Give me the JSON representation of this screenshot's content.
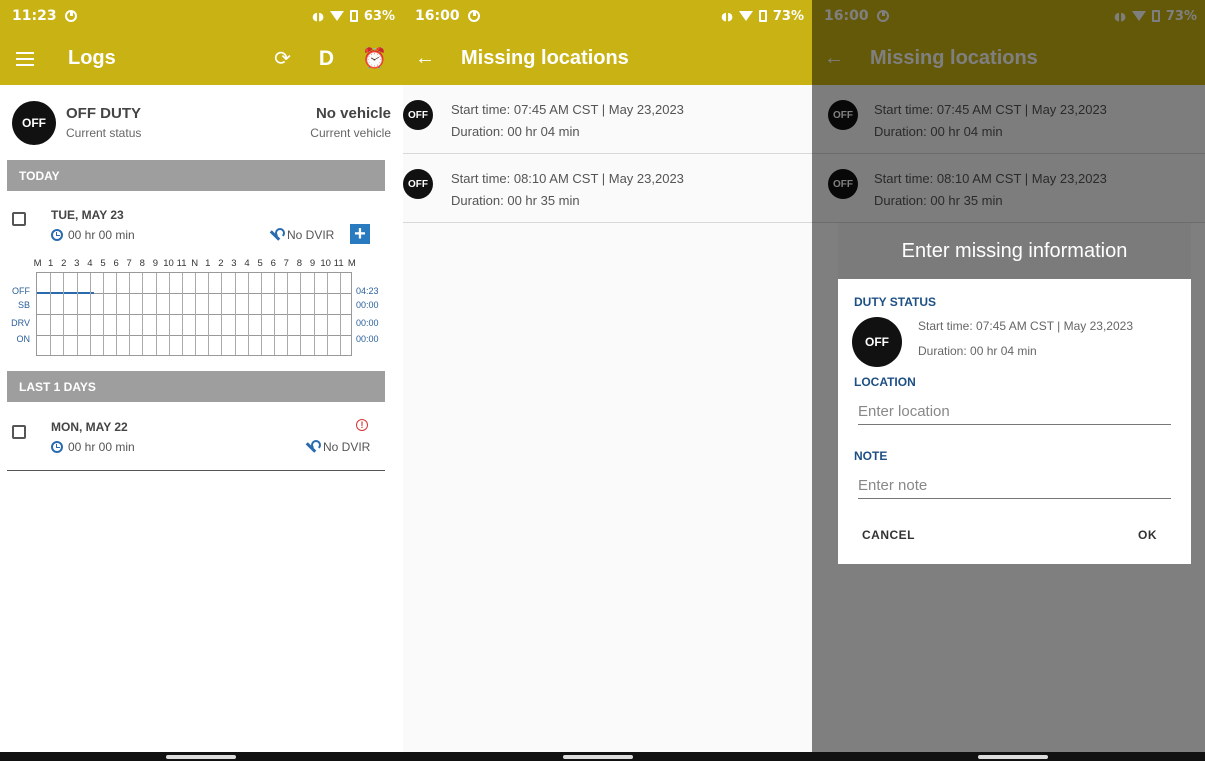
{
  "colors": {
    "appbar": "#c9b213",
    "accent_blue": "#2a6bb0",
    "alert_red": "#dd3333",
    "section_header": "#9e9e9e"
  },
  "phone1": {
    "statusbar": {
      "time": "11:23",
      "battery": "63%"
    },
    "appbar": {
      "title": "Logs",
      "menu_icon": "hamburger-menu-icon",
      "sync_icon": "sync-icon",
      "d_label": "D",
      "alarm_icon": "alarm-icon"
    },
    "status": {
      "badge": "OFF",
      "duty": "OFF DUTY",
      "duty_sub": "Current status",
      "vehicle": "No vehicle",
      "vehicle_sub": "Current vehicle"
    },
    "today_header": "TODAY",
    "today": {
      "date": "TUE, MAY 23",
      "duration": "00 hr  00 min",
      "dvir": "No DVIR",
      "add": "+"
    },
    "grid": {
      "hours": [
        "M",
        "1",
        "2",
        "3",
        "4",
        "5",
        "6",
        "7",
        "8",
        "9",
        "10",
        "11",
        "N",
        "1",
        "2",
        "3",
        "4",
        "5",
        "6",
        "7",
        "8",
        "9",
        "10",
        "11",
        "M"
      ],
      "rows": [
        {
          "label": "OFF",
          "total": "04:23"
        },
        {
          "label": "SB",
          "total": "00:00"
        },
        {
          "label": "DRV",
          "total": "00:00"
        },
        {
          "label": "ON",
          "total": "00:00"
        }
      ]
    },
    "last_header": "LAST 1 DAYS",
    "last": {
      "date": "MON, MAY 22",
      "duration": "00 hr  00 min",
      "dvir": "No DVIR",
      "alert": "!"
    }
  },
  "phone2": {
    "statusbar": {
      "time": "16:00",
      "battery": "73%"
    },
    "appbar": {
      "title": "Missing locations",
      "back_icon": "back-arrow-icon"
    },
    "items": [
      {
        "badge": "OFF",
        "start": "Start time: 07:45 AM CST | May 23,2023",
        "duration": "Duration: 00 hr  04 min"
      },
      {
        "badge": "OFF",
        "start": "Start time: 08:10 AM CST | May 23,2023",
        "duration": "Duration: 00 hr  35 min"
      }
    ]
  },
  "phone3": {
    "statusbar": {
      "time": "16:00",
      "battery": "73%"
    },
    "appbar": {
      "title": "Missing locations"
    },
    "items": [
      {
        "badge": "OFF",
        "start": "Start time: 07:45 AM CST | May 23,2023",
        "duration": "Duration: 00 hr  04 min"
      },
      {
        "badge": "OFF",
        "start": "Start time: 08:10 AM CST | May 23,2023",
        "duration": "Duration: 00 hr  35 min"
      }
    ],
    "dialog": {
      "title": "Enter missing information",
      "duty_label": "DUTY STATUS",
      "badge": "OFF",
      "start": "Start time: 07:45 AM CST | May 23,2023",
      "duration": "Duration: 00 hr  04 min",
      "location_label": "LOCATION",
      "location_placeholder": "Enter location",
      "note_label": "NOTE",
      "note_placeholder": "Enter note",
      "cancel": "CANCEL",
      "ok": "OK"
    }
  }
}
